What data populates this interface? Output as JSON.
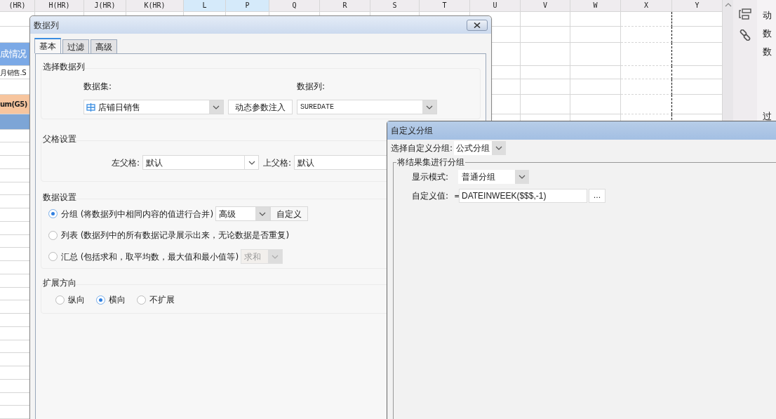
{
  "sheet": {
    "columns": [
      {
        "label": "(HR)",
        "selected": false
      },
      {
        "label": "H(HR)",
        "selected": false
      },
      {
        "label": "J(HR)",
        "selected": false
      },
      {
        "label": "K(HR)",
        "selected": false
      },
      {
        "label": "L",
        "selected": true
      },
      {
        "label": "P",
        "selected": true
      },
      {
        "label": "Q",
        "selected": false
      },
      {
        "label": "R",
        "selected": false
      },
      {
        "label": "S",
        "selected": false
      },
      {
        "label": "T",
        "selected": false
      },
      {
        "label": "U",
        "selected": false
      },
      {
        "label": "V",
        "selected": false
      },
      {
        "label": "W",
        "selected": false
      },
      {
        "label": "X",
        "selected": false
      },
      {
        "label": "Y",
        "selected": false
      }
    ],
    "rows": [
      {
        "kind": "plain"
      },
      {
        "kind": "plain"
      },
      {
        "kind": "title",
        "text": "成情况"
      },
      {
        "kind": "plain",
        "text": "月销售.S"
      },
      {
        "kind": "plain"
      },
      {
        "kind": "header",
        "text": "um(G5)"
      },
      {
        "kind": "band"
      }
    ]
  },
  "side_panel": {
    "items": [
      "动",
      "数",
      "数",
      "过"
    ]
  },
  "data_column_dialog": {
    "title": "数据列",
    "tabs": [
      {
        "label": "基本",
        "selected": true
      },
      {
        "label": "过滤",
        "selected": false
      },
      {
        "label": "高级",
        "selected": false
      }
    ],
    "select_section": {
      "title": "选择数据列",
      "dataset_label": "数据集:",
      "dataset": "店铺日销售",
      "inject_button": "动态参数注入",
      "column_label": "数据列:",
      "column": "SUREDATE"
    },
    "parent_section": {
      "title": "父格设置",
      "left_label": "左父格:",
      "left_value": "默认",
      "top_label": "上父格:",
      "top_value": "默认"
    },
    "data_section": {
      "title": "数据设置",
      "options": [
        {
          "label": "分组 (将数据列中相同内容的值进行合并)",
          "selected": true,
          "kind": "group",
          "select": "高级",
          "select_disabled": false,
          "button": "自定义"
        },
        {
          "label": "列表 (数据列中的所有数据记录展示出来，无论数据是否重复)",
          "selected": false,
          "kind": "list"
        },
        {
          "label": "汇总 (包括求和，取平均数，最大值和最小值等)",
          "selected": false,
          "kind": "summary",
          "select": "求和",
          "select_disabled": true
        }
      ]
    },
    "expand_section": {
      "title": "扩展方向",
      "options": [
        {
          "label": "纵向",
          "selected": false
        },
        {
          "label": "横向",
          "selected": true
        },
        {
          "label": "不扩展",
          "selected": false
        }
      ]
    }
  },
  "custom_group_dialog": {
    "title": "自定义分组",
    "type_label": "选择自定义分组:",
    "type_value": "公式分组",
    "group_title": "将结果集进行分组",
    "mode_label": "显示模式:",
    "mode_value": "普通分组",
    "value_label": "自定义值:",
    "equals": "=",
    "value": "DATEINWEEK($$$,-1)",
    "more_button": "..."
  }
}
